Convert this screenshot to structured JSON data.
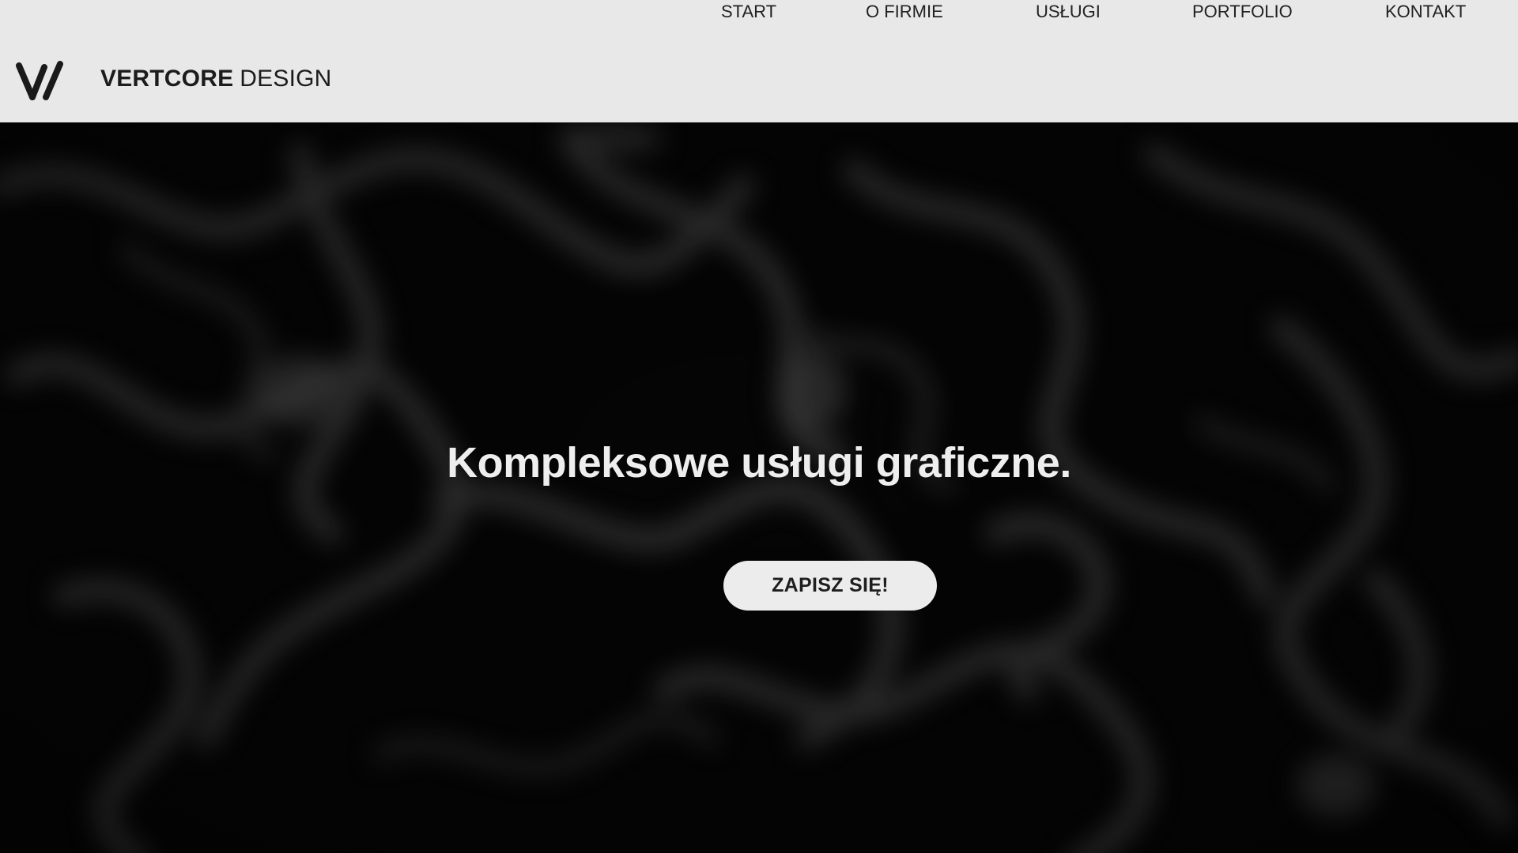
{
  "header": {
    "logo_icon": "vertcore-v-logo",
    "brand_bold": "VERTCORE",
    "brand_light": "DESIGN"
  },
  "nav": {
    "items": [
      {
        "label": "START"
      },
      {
        "label": "O FIRMIE"
      },
      {
        "label": "USŁUGI"
      },
      {
        "label": "PORTFOLIO"
      },
      {
        "label": "KONTAKT"
      }
    ]
  },
  "hero": {
    "title": "Kompleksowe usługi graficzne.",
    "cta_label": "ZAPISZ SIĘ!",
    "background": "dark blurred abstract pattern"
  },
  "colors": {
    "header_bg": "#e8e8e8",
    "text_dark": "#1c1c1c",
    "hero_bg": "#050505",
    "hero_text": "#eeeeee",
    "cta_bg": "#ececec"
  }
}
